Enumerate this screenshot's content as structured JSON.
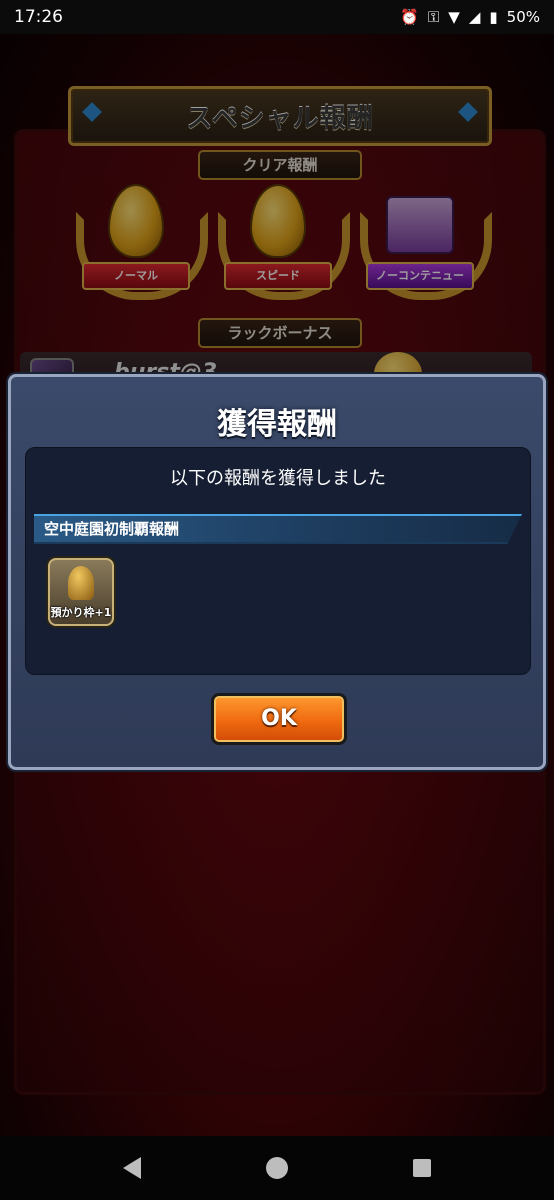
{
  "status_bar": {
    "time": "17:26",
    "battery": "50%",
    "icons": [
      "alarm-icon",
      "key-icon",
      "wifi-icon",
      "signal-icon",
      "battery-icon"
    ]
  },
  "background_screen": {
    "title": "スペシャル報酬",
    "clear_reward_label": "クリア報酬",
    "rewards": [
      {
        "label": "ノーマル",
        "color": "#c0141c"
      },
      {
        "label": "スピード",
        "color": "#c0141c"
      },
      {
        "label": "ノーコンテニュー",
        "color": "#8a22c0"
      }
    ],
    "luck_bonus_label": "ラックボーナス",
    "player_name": "burst@3"
  },
  "dialog": {
    "title": "獲得報酬",
    "message": "以下の報酬を獲得しました",
    "category": "空中庭園初制覇報酬",
    "reward_item_label": "預かり枠+1",
    "ok_label": "OK"
  },
  "colors": {
    "accent_gold": "#c9962c",
    "ok_button": "#f06a10",
    "dialog_bg": "#2e3a56"
  }
}
